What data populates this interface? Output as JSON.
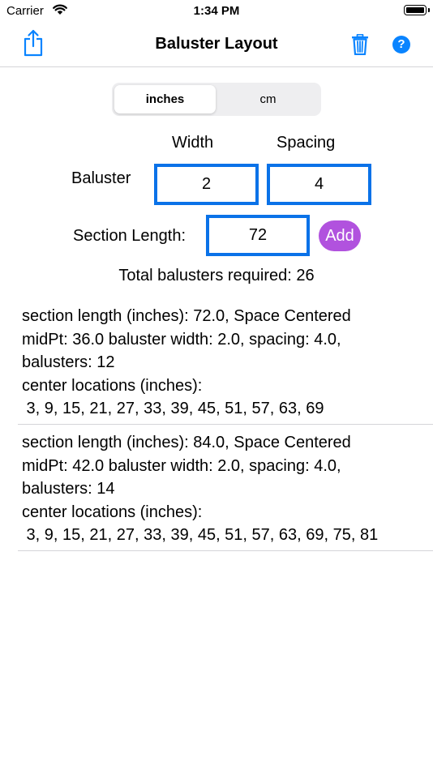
{
  "status": {
    "carrier": "Carrier",
    "time": "1:34 PM"
  },
  "nav": {
    "title": "Baluster Layout",
    "help_label": "?"
  },
  "units": {
    "options": [
      "inches",
      "cm"
    ],
    "selected": "inches"
  },
  "form": {
    "width_header": "Width",
    "spacing_header": "Spacing",
    "baluster_label": "Baluster",
    "width_value": "2",
    "spacing_value": "4",
    "section_length_label": "Section Length:",
    "section_length_value": "72",
    "add_label": "Add"
  },
  "total": "Total balusters required: 26",
  "sections": [
    {
      "line1": "section length (inches): 72.0, Space Centered",
      "line2": "midPt: 36.0 baluster width: 2.0, spacing: 4.0,",
      "line3": "balusters: 12",
      "line4": "center locations (inches):",
      "line5": " 3, 9, 15, 21, 27, 33, 39, 45, 51, 57, 63, 69"
    },
    {
      "line1": "section length (inches): 84.0, Space Centered",
      "line2": "midPt: 42.0 baluster width: 2.0, spacing: 4.0,",
      "line3": "balusters: 14",
      "line4": "center locations (inches):",
      "line5": " 3, 9, 15, 21, 27, 33, 39, 45, 51, 57, 63, 69, 75, 81"
    }
  ],
  "colors": {
    "accent": "#0a84ff",
    "input_border": "#0a72e8",
    "add_button": "#b152de"
  }
}
